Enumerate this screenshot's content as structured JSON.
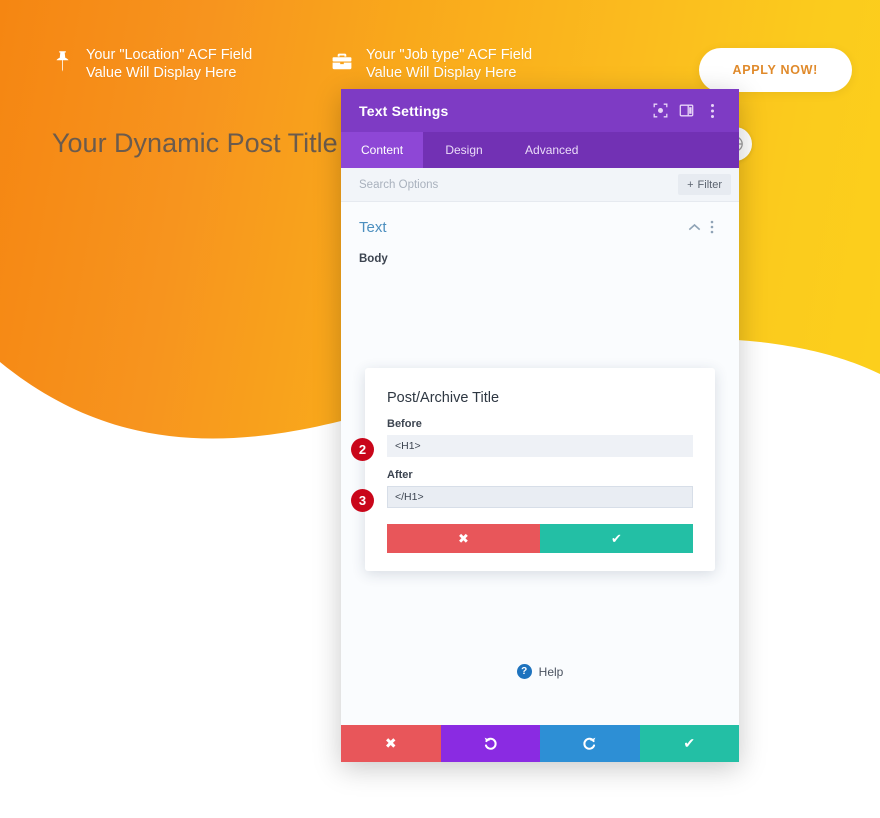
{
  "hero": {
    "title": "Your Dynamic Post Title Will",
    "apply_button": "APPLY NOW!",
    "meta": [
      {
        "icon": "map-pin-icon",
        "text": "Your \"Location\" ACF Field\nValue Will Display Here"
      },
      {
        "icon": "briefcase-icon",
        "text": "Your \"Job type\" ACF Field\nValue Will Display Here"
      }
    ],
    "round_icon": "globe-icon",
    "colors": {
      "gradient_start": "#F58612",
      "gradient_end": "#FCD01C",
      "title_text": "#6B5B4D",
      "apply_text": "#E08A2B"
    }
  },
  "panel": {
    "title": "Text Settings",
    "titlebar_icons": [
      "target-icon",
      "layout-panel-icon",
      "kebab-menu-icon"
    ],
    "tabs": [
      {
        "label": "Content",
        "active": true
      },
      {
        "label": "Design",
        "active": false
      },
      {
        "label": "Advanced",
        "active": false
      }
    ],
    "search": {
      "placeholder": "Search Options",
      "value": "",
      "filter_label": "Filter",
      "filter_icon": "plus-icon"
    },
    "section": {
      "title": "Text",
      "collapse_icon": "chevron-up-icon",
      "options_icon": "kebab-menu-icon"
    },
    "field_label": "Body",
    "dynamic_card": {
      "title": "Post/Archive Title",
      "before": {
        "label": "Before",
        "value": "<H1>",
        "badge": "2"
      },
      "after": {
        "label": "After",
        "value": "</H1>",
        "badge": "3"
      },
      "cancel_icon": "times-icon",
      "confirm_icon": "check-icon"
    },
    "help": {
      "icon": "question-circle-icon",
      "label": "Help"
    },
    "footer_buttons": [
      {
        "name": "cancel",
        "icon": "times-icon",
        "color": "#E8565A"
      },
      {
        "name": "undo",
        "icon": "undo-icon",
        "color": "#8A2BE2"
      },
      {
        "name": "redo",
        "icon": "redo-icon",
        "color": "#2D8FD5"
      },
      {
        "name": "save",
        "icon": "check-icon",
        "color": "#23BFA5"
      }
    ],
    "colors": {
      "titlebar": "#7E3BC4",
      "tabs_bg": "#7231B4",
      "tab_active": "#8E47D6",
      "badge_red": "#C9061A"
    }
  }
}
